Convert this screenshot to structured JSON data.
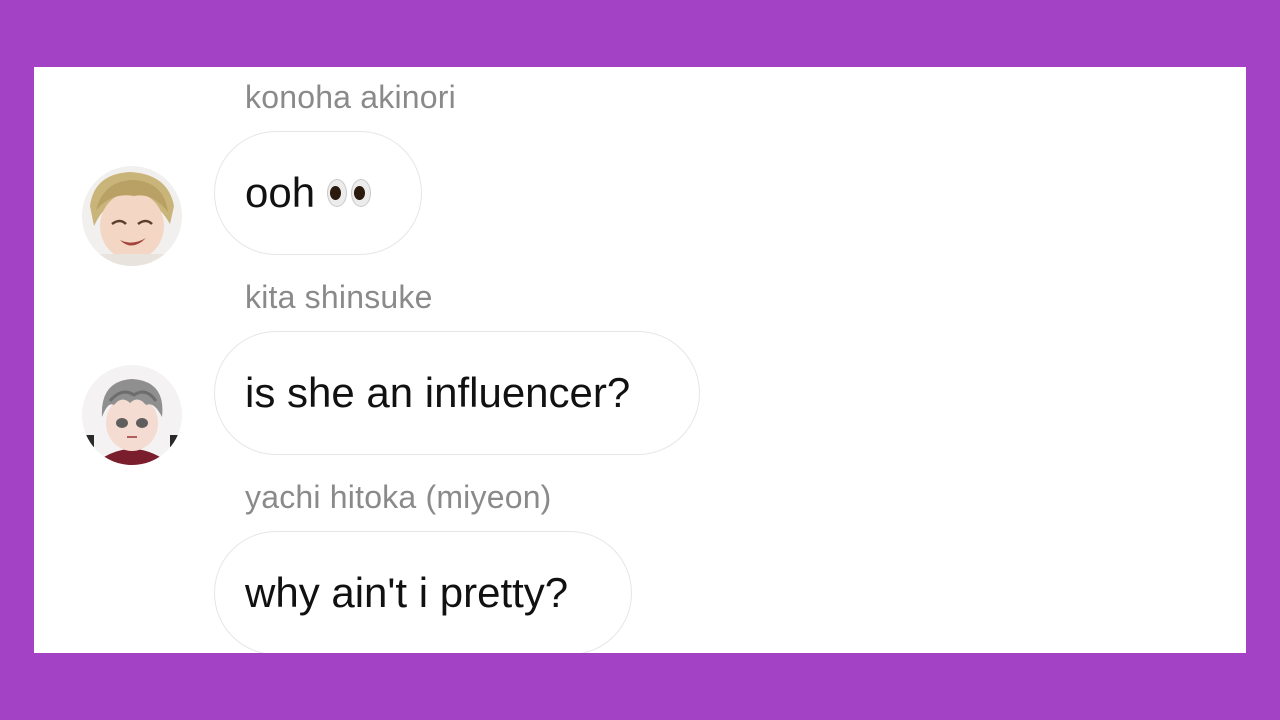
{
  "colors": {
    "frame": "#A442C6",
    "panel": "#FFFFFF",
    "sender_text": "#8A8A8A",
    "message_text": "#111111",
    "bubble_border": "#E6E6E6"
  },
  "messages": [
    {
      "sender": "konoha akinori",
      "text": "ooh",
      "emoji": "eyes-emoji",
      "avatar": "blond-haired-anime-avatar"
    },
    {
      "sender": "kita shinsuke",
      "text": "is she an influencer?",
      "avatar": "grey-haired-anime-avatar"
    },
    {
      "sender": "yachi hitoka (miyeon)",
      "text": "why ain't i pretty?"
    }
  ]
}
